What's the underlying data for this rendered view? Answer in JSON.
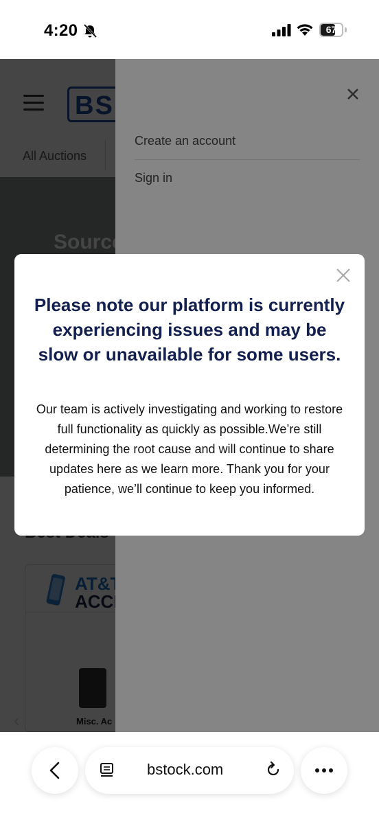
{
  "status_bar": {
    "time": "4:20",
    "battery_level": "67",
    "icons": [
      "bell-slash-icon",
      "cellular-signal-icon",
      "wifi-icon",
      "battery-icon"
    ]
  },
  "page": {
    "nav_all_auctions": "All Auctions",
    "hero_text": "Source",
    "best_deals": "Best Deals",
    "card": {
      "brand_line1": "AT&T",
      "brand_line2": "ACCE",
      "product_label": "Misc. Ac"
    },
    "logo_text": "BS"
  },
  "drawer": {
    "create_account": "Create an account",
    "sign_in": "Sign in"
  },
  "modal": {
    "title": "Please note our platform is currently experiencing issues and may be slow or unavailable for some users.",
    "body": "Our team is actively investigating and working to restore full functionality as quickly as possible.We’re still determining the root cause and will continue to share updates here as we learn more. Thank you for your patience, we’ll continue to keep you informed."
  },
  "browser": {
    "url": "bstock.com"
  },
  "colors": {
    "modal_title": "#13204f",
    "brand_blue": "#1d4e9c",
    "att_blue": "#1e6fc2"
  }
}
